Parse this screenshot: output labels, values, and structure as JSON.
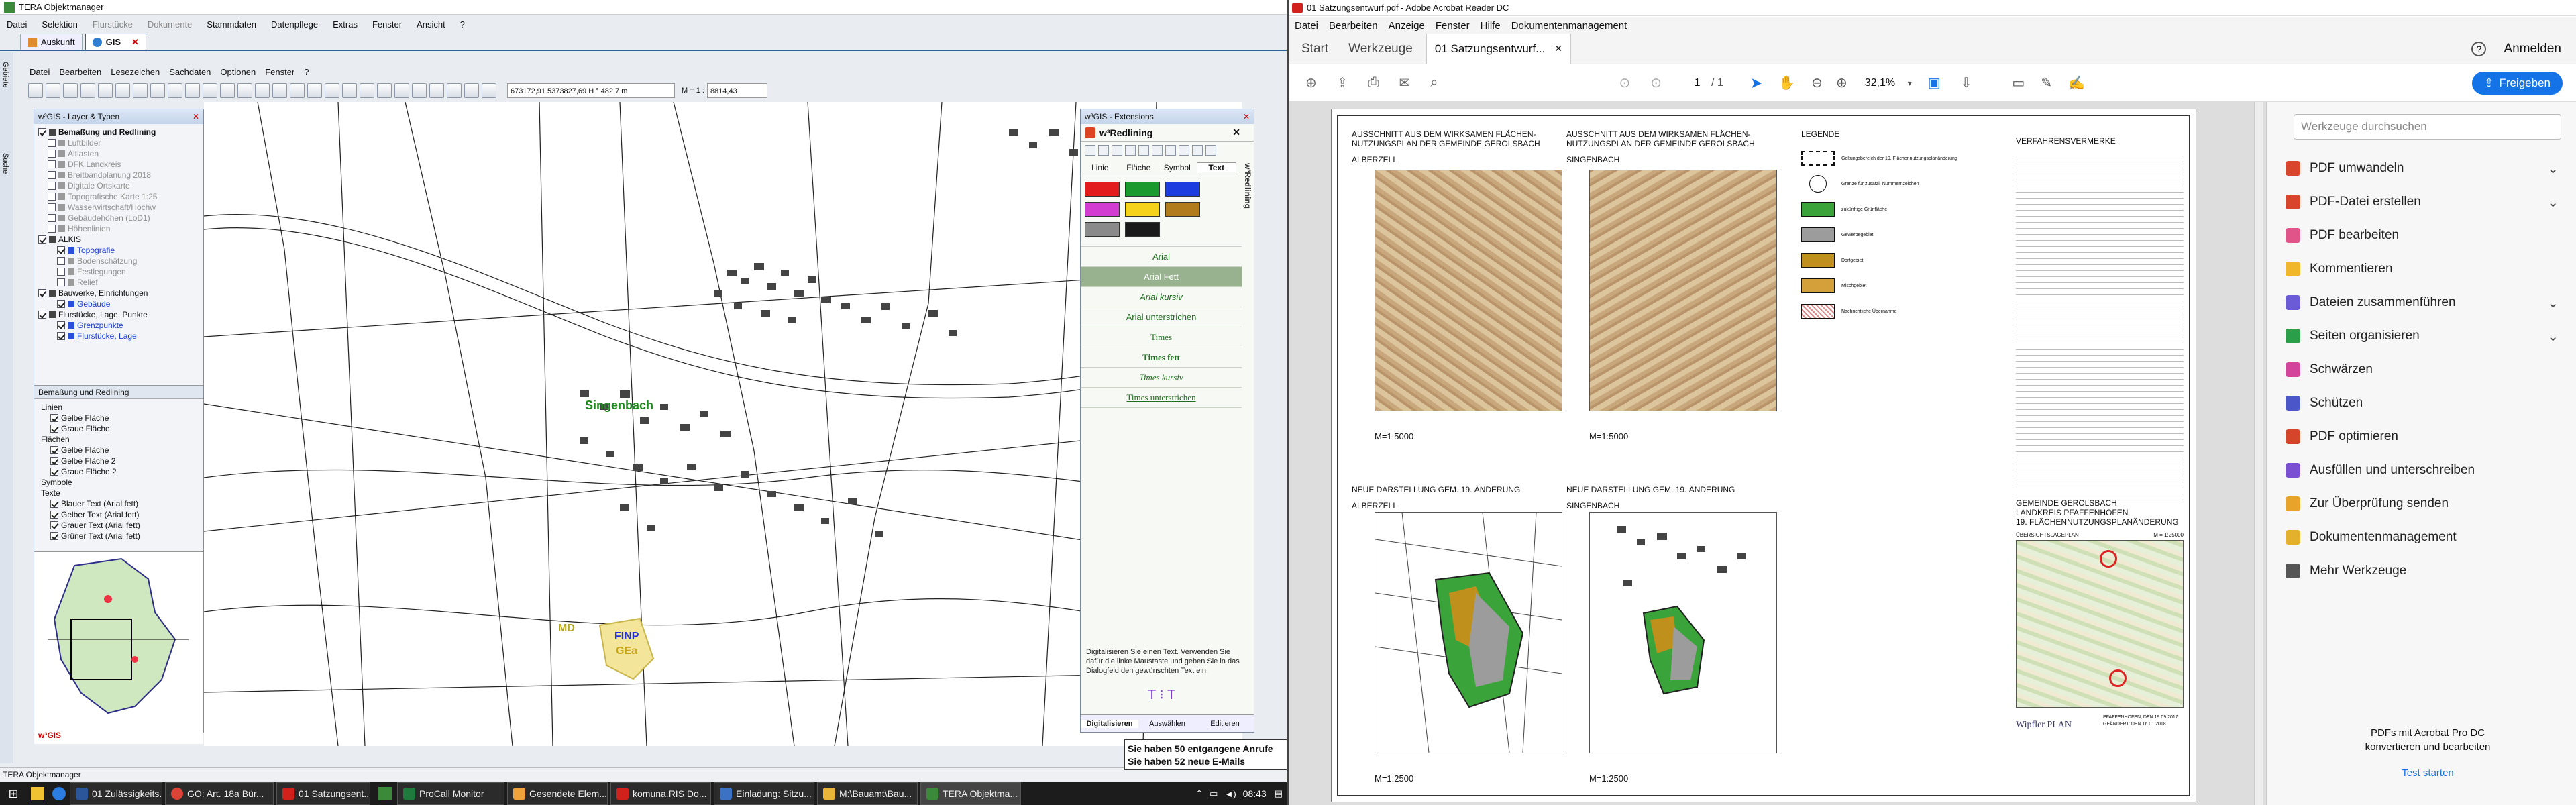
{
  "tera": {
    "title": "TERA Objektmanager",
    "menu": [
      "Datei",
      "Selektion",
      "Flurstücke",
      "Dokumente",
      "Stammdaten",
      "Datenpflege",
      "Extras",
      "Fenster",
      "Ansicht",
      "?"
    ],
    "tabs": [
      {
        "label": "Auskunft"
      },
      {
        "label": "GIS"
      }
    ],
    "gis_menu": [
      "Datei",
      "Bearbeiten",
      "Lesezeichen",
      "Sachdaten",
      "Optionen",
      "Fenster",
      "?"
    ],
    "coords": "673172,91 5373827,69 H ° 482,7 m",
    "scale_label": "M = 1 :",
    "scale_value": "8814,43",
    "side_labels": [
      "Gebiete",
      "Suche"
    ],
    "layer_panel_title": "w³GIS - Layer & Typen",
    "layers": [
      {
        "label": "Bemaßung und Redlining",
        "style": "bold"
      },
      {
        "label": "Luftbilder",
        "style": "grey"
      },
      {
        "label": "Altlasten",
        "style": "grey"
      },
      {
        "label": "DFK Landkreis",
        "style": "grey"
      },
      {
        "label": "Breitbandplanung 2018",
        "style": "grey"
      },
      {
        "label": "Digitale Ortskarte",
        "style": "grey"
      },
      {
        "label": "Topografische Karte 1:25",
        "style": "grey"
      },
      {
        "label": "Wasserwirtschaft/Hochw",
        "style": "grey"
      },
      {
        "label": "Gebäudehöhen (LoD1)",
        "style": "grey"
      },
      {
        "label": "Höhenlinien",
        "style": "grey"
      },
      {
        "label": "ALKIS",
        "style": "normal"
      },
      {
        "label": "Topografie",
        "style": "blue"
      },
      {
        "label": "Bodenschätzung",
        "style": "grey"
      },
      {
        "label": "Festlegungen",
        "style": "grey"
      },
      {
        "label": "Relief",
        "style": "grey"
      },
      {
        "label": "Bauwerke, Einrichtungen",
        "style": "normal"
      },
      {
        "label": "Gebäude",
        "style": "blue"
      },
      {
        "label": "Flurstücke, Lage, Punkte",
        "style": "normal"
      },
      {
        "label": "Grenzpunkte",
        "style": "blue"
      },
      {
        "label": "Flurstücke, Lage",
        "style": "blue"
      }
    ],
    "types_panel_title": "Bemaßung und Redlining",
    "types": [
      {
        "label": "Linien",
        "indent": 0
      },
      {
        "label": "Gelbe Fläche",
        "indent": 1
      },
      {
        "label": "Graue Fläche",
        "indent": 1
      },
      {
        "label": "Flächen",
        "indent": 0
      },
      {
        "label": "Gelbe Fläche",
        "indent": 1
      },
      {
        "label": "Gelbe Fläche 2",
        "indent": 1
      },
      {
        "label": "Graue Fläche 2",
        "indent": 1
      },
      {
        "label": "Symbole",
        "indent": 0
      },
      {
        "label": "Texte",
        "indent": 0
      },
      {
        "label": "Blauer Text (Arial fett)",
        "indent": 1
      },
      {
        "label": "Gelber Text (Arial fett)",
        "indent": 1
      },
      {
        "label": "Grauer Text (Arial fett)",
        "indent": 1
      },
      {
        "label": "Grüner Text (Arial fett)",
        "indent": 1
      }
    ],
    "overview_logo": "w³GIS",
    "map_labels": {
      "town": "Singenbach",
      "md": "MD",
      "finp": "FINP",
      "ge": "GEa"
    },
    "extensions_title": "w³GIS - Extensions",
    "redlining_title": "w³Redlining",
    "redlining_side": "w³Redlining",
    "redlining_tabs": [
      "Linie",
      "Fläche",
      "Symbol",
      "Text"
    ],
    "colors": [
      "#e21c1c",
      "#1a9a2e",
      "#1c3ce0",
      "#d23cd0",
      "#f5d21b",
      "#b07c1c",
      "#8a8a8a",
      "#1a1a1a"
    ],
    "text_styles": [
      "Arial",
      "Arial Fett",
      "Arial kursiv",
      "Arial unterstrichen",
      "Times",
      "Times fett",
      "Times kursiv",
      "Times unterstrichen"
    ],
    "instruction": "Digitalisieren Sie einen Text. Verwenden Sie dafür die linke Maustaste und geben Sie in das Dialogfeld den gewünschten Text ein.",
    "bottom_tabs": [
      "Digitalisieren",
      "Auswählen",
      "Editieren"
    ],
    "status": "TERA Objektmanager",
    "notification": [
      "Sie haben 50 entgangene Anrufe",
      "Sie haben 52 neue E-Mails"
    ]
  },
  "taskbar": {
    "items": [
      "01 Zulässigkeits...",
      "GO: Art. 18a Bür...",
      "01 Satzungsent...",
      "ProCall Monitor",
      "Gesendete Elem...",
      "komuna.RIS Do...",
      "Einladung: Sitzu...",
      "M:\\Bauamt\\Bau...",
      "TERA Objektma..."
    ],
    "time": "08:43"
  },
  "acrobat": {
    "title": "01 Satzungsentwurf.pdf - Adobe Acrobat Reader DC",
    "menu": [
      "Datei",
      "Bearbeiten",
      "Anzeige",
      "Fenster",
      "Hilfe",
      "Dokumentenmanagement"
    ],
    "tabs": [
      "Start",
      "Werkzeuge",
      "01 Satzungsentwurf..."
    ],
    "help": "?",
    "login": "Anmelden",
    "page_current": "1",
    "page_total": "/ 1",
    "zoom": "32,1%",
    "share": "Freigeben",
    "search_placeholder": "Werkzeuge durchsuchen",
    "tools": [
      {
        "label": "PDF umwandeln",
        "color": "#d9442c",
        "chevron": true
      },
      {
        "label": "PDF-Datei erstellen",
        "color": "#d9442c",
        "chevron": true
      },
      {
        "label": "PDF bearbeiten",
        "color": "#e0548a",
        "chevron": false
      },
      {
        "label": "Kommentieren",
        "color": "#f1b72a",
        "chevron": false
      },
      {
        "label": "Dateien zusammenführen",
        "color": "#6b5bd6",
        "chevron": true
      },
      {
        "label": "Seiten organisieren",
        "color": "#2b9e4a",
        "chevron": true
      },
      {
        "label": "Schwärzen",
        "color": "#d3459b",
        "chevron": false
      },
      {
        "label": "Schützen",
        "color": "#4b57c9",
        "chevron": false
      },
      {
        "label": "PDF optimieren",
        "color": "#d4452c",
        "chevron": false
      },
      {
        "label": "Ausfüllen und unterschreiben",
        "color": "#7a4fd1",
        "chevron": false
      },
      {
        "label": "Zur Überprüfung senden",
        "color": "#e8a42a",
        "chevron": false
      },
      {
        "label": "Dokumentenmanagement",
        "color": "#e3b12b",
        "chevron": false
      },
      {
        "label": "Mehr Werkzeuge",
        "color": "#555555",
        "chevron": false
      }
    ],
    "promo": [
      "PDFs mit Acrobat Pro DC",
      "konvertieren und bearbeiten"
    ],
    "promo_link": "Test starten"
  },
  "pdf": {
    "h1": [
      "AUSSCHNITT AUS DEM WIRKSAMEN FLÄCHEN-",
      "NUTZUNGSPLAN DER GEMEINDE GEROLSBACH"
    ],
    "sub1": "ALBERZELL",
    "sub2": "SINGENBACH",
    "scale_top": "M=1:5000",
    "h_new1": "NEUE DARSTELLUNG GEM. 19. ÄNDERUNG",
    "scale_bottom": "M=1:2500",
    "legend_title": "LEGENDE",
    "legend": [
      "Geltungsbereich der 19. Flächennutzungsplanänderung",
      "Grenze für zusätzl. Nummernzeichen",
      "zukünftige Grünfläche",
      "Gewerbegebiet",
      "Dorfgebiet",
      "Mischgebiet",
      "Nachrichtliche Übernahme"
    ],
    "procedures_title": "VERFAHRENSVERMERKE",
    "block": [
      "GEMEINDE GEROLSBACH",
      "LANDKREIS PFAFFENHOFEN",
      "19. FLÄCHENNUTZUNGSPLANÄNDERUNG"
    ],
    "overview_label": "ÜBERSICHTSLAGEPLAN",
    "overview_scale": "M = 1:25000",
    "designer": "Wipfler PLAN",
    "date1": "PFAFFENHOFEN, DEN 19.09.2017",
    "date2": "GEÄNDERT: DEN 16.01.2018"
  }
}
